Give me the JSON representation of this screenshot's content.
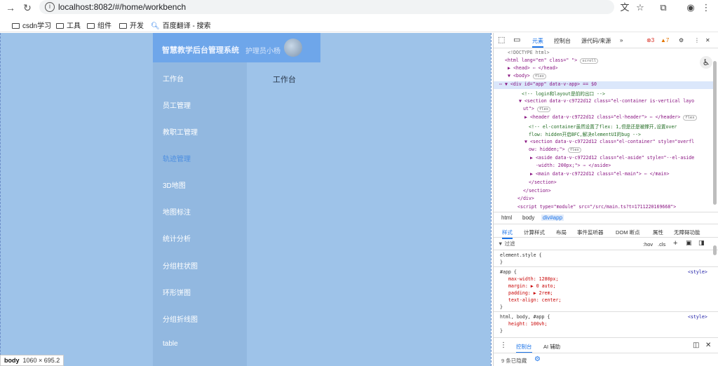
{
  "browser": {
    "url": "localhost:8082/#/home/workbench",
    "bookmarks": [
      "csdn学习",
      "工具",
      "组件",
      "开发",
      "百度翻译 - 搜索"
    ]
  },
  "app": {
    "title": "智慧教学后台管理系统",
    "user": "护理员小杨",
    "menu": [
      "工作台",
      "员工管理",
      "教职工管理",
      "轨迹管理",
      "3D地图",
      "地图标注",
      "统计分析",
      "分组柱状图",
      "环形饼图",
      "分组折线图",
      "table"
    ],
    "main_title": "工作台",
    "accent_color": "#4c8ee0"
  },
  "tooltip": {
    "tag": "body",
    "size": "1060 × 695.2"
  },
  "devtools": {
    "tabs": [
      "元素",
      "控制台",
      "源代码/来源"
    ],
    "more": "»",
    "errors": "3",
    "warnings": "7",
    "dom_lines": [
      "<!DOCTYPE html>",
      "<html lang=\"en\" class=\" \">",
      "▶ <head> ⋯ </head>",
      "▼ <body>",
      "▼ <div id=\"app\" data-v-app> == $0",
      "<!-- login和layout是前的出口 -->",
      "▼ <section data-v-c9722d12 class=\"el-container is-vertical layo",
      "ut\">",
      "▶ <header data-v-c9722d12 class=\"el-header\"> ⋯ </header>",
      "<!-- el-container虽然设置了flex: 1,但是还是被撑开,设置over",
      "flow: hidden开启BFC,解决elementUI的bug -->",
      "▼ <section data-v-c9722d12 class=\"el-container\" style=\"overfl",
      "ow: hidden;\">",
      "▶ <aside data-v-c9722d12 class=\"el-aside\" style=\"--el-aside",
      "-width: 200px;\"> ⋯ </aside>",
      "▶ <main data-v-c9722d12 class=\"el-main\"> ⋯ </main>",
      "</section>",
      "</section>",
      "</div>",
      "<script type=\"module\" src=\"/src/main.ts?t=1711220169668\">"
    ],
    "badges": {
      "scroll": "scroll",
      "flex": "flex"
    },
    "breadcrumbs": [
      "html",
      "body",
      "div#app"
    ],
    "styles_tabs": [
      "样式",
      "计算样式",
      "布局",
      "事件监听器",
      "DOM 断点",
      "属性",
      "无障碍功能"
    ],
    "filter_placeholder": "过滤",
    "filter_hov": ":hov",
    "filter_cls": ".cls",
    "css_lines": [
      "element.style {",
      "}",
      "#app {",
      "max-width: 1280px;",
      "margin: ▶ 0 auto;",
      "padding: ▶ 2rem;",
      "text-align: center;",
      "}",
      "html, body, #app {",
      "height: 100vh;",
      "}"
    ],
    "source_link": "<style>",
    "drawer_tabs": [
      "控制台",
      "AI 辅助"
    ],
    "hidden_count": "9 条已隐藏"
  }
}
